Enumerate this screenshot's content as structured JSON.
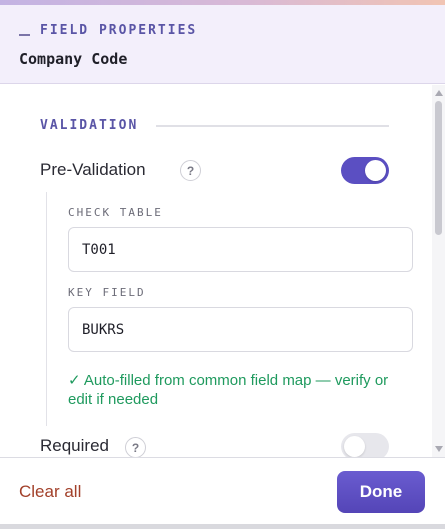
{
  "header": {
    "eyebrow": "FIELD PROPERTIES",
    "field_name": "Company Code"
  },
  "validation": {
    "section_title": "VALIDATION",
    "pre_validation": {
      "label": "Pre-Validation",
      "help_glyph": "?",
      "enabled": true
    },
    "check_table": {
      "label": "CHECK TABLE",
      "value": "T001"
    },
    "key_field": {
      "label": "KEY FIELD",
      "value": "BUKRS"
    },
    "hint": "✓ Auto-filled from common field map — verify or edit if needed",
    "required": {
      "label": "Required",
      "help_glyph": "?",
      "enabled": false
    }
  },
  "footer": {
    "clear_label": "Clear all",
    "done_label": "Done"
  },
  "colors": {
    "accent": "#5b4fc2",
    "success": "#1f9a5e",
    "danger": "#a2402a"
  }
}
